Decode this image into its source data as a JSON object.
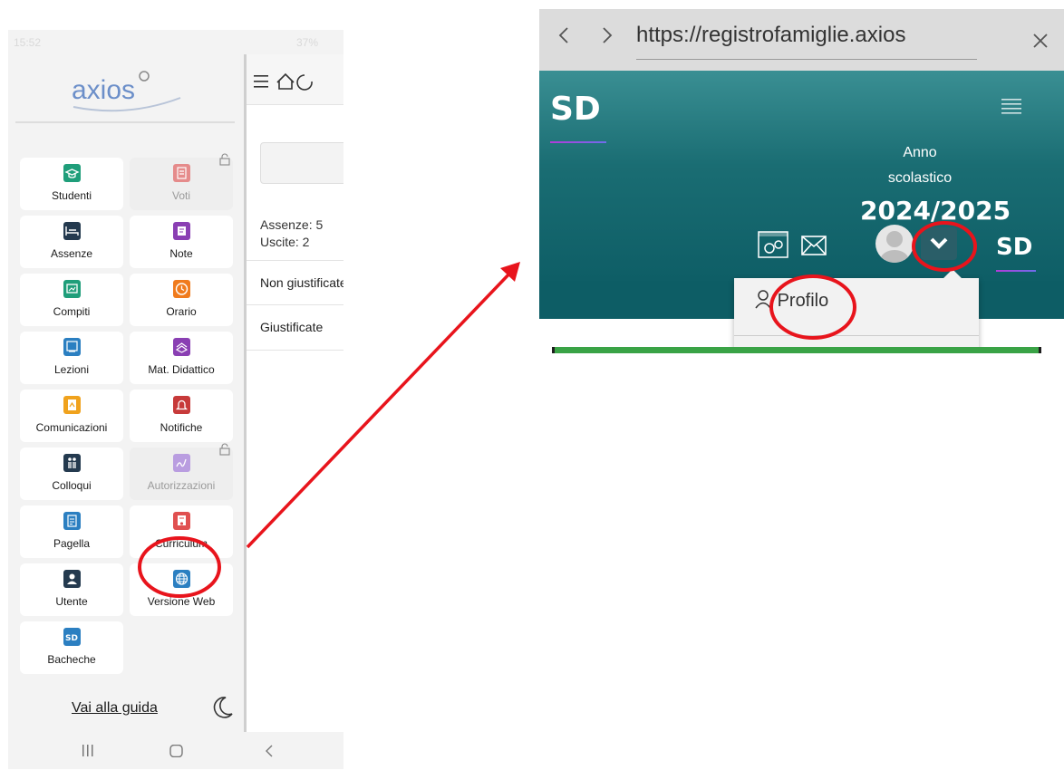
{
  "phone": {
    "status": {
      "time": "15:52",
      "battery": "37%"
    },
    "logo_text": "axios",
    "tiles": [
      {
        "label": "Studenti",
        "icon": "graduation-cap-icon",
        "color": "#1f9e7a",
        "locked": false
      },
      {
        "label": "Voti",
        "icon": "grades-icon",
        "color": "#e58b8b",
        "locked": true
      },
      {
        "label": "Assenze",
        "icon": "bed-icon",
        "color": "#243a4f",
        "locked": false
      },
      {
        "label": "Note",
        "icon": "note-icon",
        "color": "#8a3fb3",
        "locked": false
      },
      {
        "label": "Compiti",
        "icon": "chalkboard-icon",
        "color": "#1f9e7a",
        "locked": false
      },
      {
        "label": "Orario",
        "icon": "clock-icon",
        "color": "#f07b1d",
        "locked": false
      },
      {
        "label": "Lezioni",
        "icon": "lesson-icon",
        "color": "#2b7fc1",
        "locked": false
      },
      {
        "label": "Mat. Didattico",
        "icon": "books-icon",
        "color": "#8a3fb3",
        "locked": false
      },
      {
        "label": "Comunicazioni",
        "icon": "pdf-icon",
        "color": "#f0a21d",
        "locked": false
      },
      {
        "label": "Notifiche",
        "icon": "bell-icon",
        "color": "#c73a3a",
        "locked": false
      },
      {
        "label": "Colloqui",
        "icon": "people-icon",
        "color": "#243a4f",
        "locked": false
      },
      {
        "label": "Autorizzazioni",
        "icon": "signature-icon",
        "color": "#b99de0",
        "locked": true
      },
      {
        "label": "Pagella",
        "icon": "report-card-icon",
        "color": "#2b7fc1",
        "locked": false
      },
      {
        "label": "Curriculum",
        "icon": "certificate-icon",
        "color": "#e05050",
        "locked": false
      },
      {
        "label": "Utente",
        "icon": "user-icon",
        "color": "#243a4f",
        "locked": false
      },
      {
        "label": "Versione Web",
        "icon": "globe-icon",
        "color": "#2b7fc1",
        "locked": false
      },
      {
        "label": "Bacheche",
        "icon": "sd-icon",
        "color": "#2b7fc1",
        "locked": false
      }
    ],
    "guide_link": "Vai alla guida",
    "main": {
      "assenze": "Assenze: 5",
      "uscite": "Uscite: 2",
      "row1": "Non giustificate",
      "row2": "Giustificate"
    }
  },
  "browser": {
    "url": "https://registrofamiglie.axios",
    "site": {
      "logo": "SD",
      "anno_label_1": "Anno",
      "anno_label_2": "scolastico",
      "year": "2024/2025",
      "logo_small": "SD",
      "dropdown_item": "Profilo"
    }
  },
  "annotation_color": "#e8141c"
}
